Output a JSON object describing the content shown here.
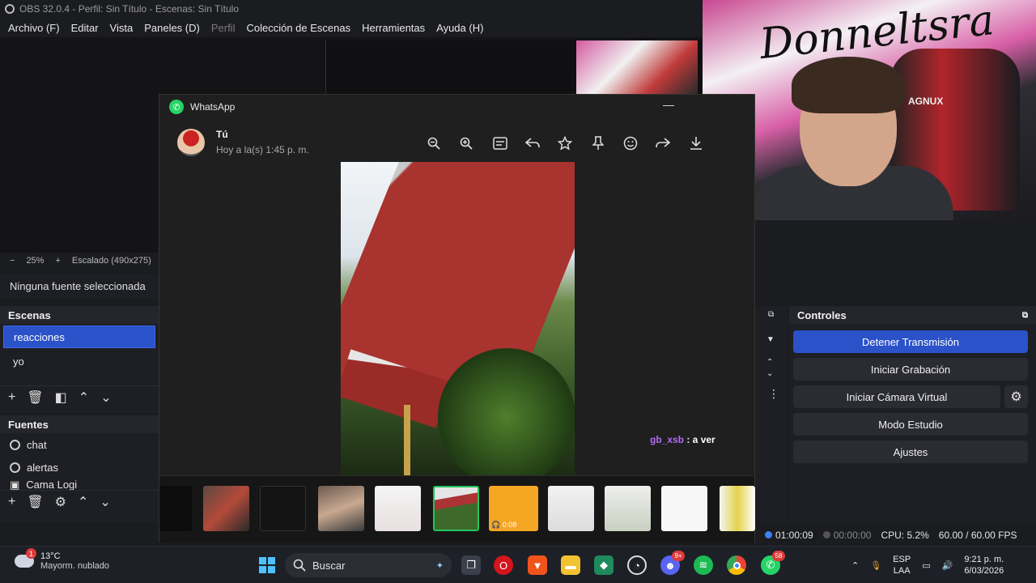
{
  "obs": {
    "title": "OBS 32.0.4 - Perfil: Sin Título - Escenas: Sin Título",
    "menu": [
      "Archivo (F)",
      "Editar",
      "Vista",
      "Paneles (D)",
      "Perfil",
      "Colección de Escenas",
      "Herramientas",
      "Ayuda (H)"
    ],
    "zoom": "25%",
    "scale_label": "Escalado (490x275)",
    "no_source": "Ninguna fuente seleccionada",
    "scenes_title": "Escenas",
    "scenes": [
      "reacciones",
      "yo"
    ],
    "sources_title": "Fuentes",
    "sources": [
      "chat",
      "alertas",
      "Cama Logi"
    ],
    "controls_title": "Controles",
    "controls": {
      "stop_stream": "Detener Transmisión",
      "start_recording": "Iniciar Grabación",
      "virtual_cam": "Iniciar Cámara Virtual",
      "studio_mode": "Modo Estudio",
      "settings": "Ajustes"
    },
    "status": {
      "live_time": "01:00:09",
      "rec_time": "00:00:00",
      "cpu": "CPU: 5.2%",
      "fps": "60.00 / 60.00 FPS"
    }
  },
  "webcam": {
    "graffiti": "Donneltsra",
    "chair_badge": "AGNUX"
  },
  "whatsapp": {
    "title": "WhatsApp",
    "sender": "Tú",
    "timestamp": "Hoy a la(s) 1:45 p. m.",
    "chat_user": "gb_xsb",
    "chat_text": " : a ver",
    "audio_duration": "0:08",
    "tools": [
      "zoom-out-icon",
      "zoom-in-icon",
      "caption-icon",
      "reply-icon",
      "star-icon",
      "pin-icon",
      "emoji-icon",
      "forward-icon",
      "download-icon"
    ]
  },
  "taskbar": {
    "temperature": "13°C",
    "weather": "Mayorm. nublado",
    "weather_badge": "1",
    "search_placeholder": "Buscar",
    "discord_badge": "9+",
    "whatsapp_badge": "58",
    "lang_top": "ESP",
    "lang_bottom": "LAA",
    "time": "9:21 p. m.",
    "date": "6/03/2026"
  },
  "colors": {
    "accent": "#2b52c9",
    "whatsapp": "#25d366",
    "chat_user": "#b36bf5",
    "live": "#3b82f6",
    "selected_thumb": "#22c55e"
  }
}
